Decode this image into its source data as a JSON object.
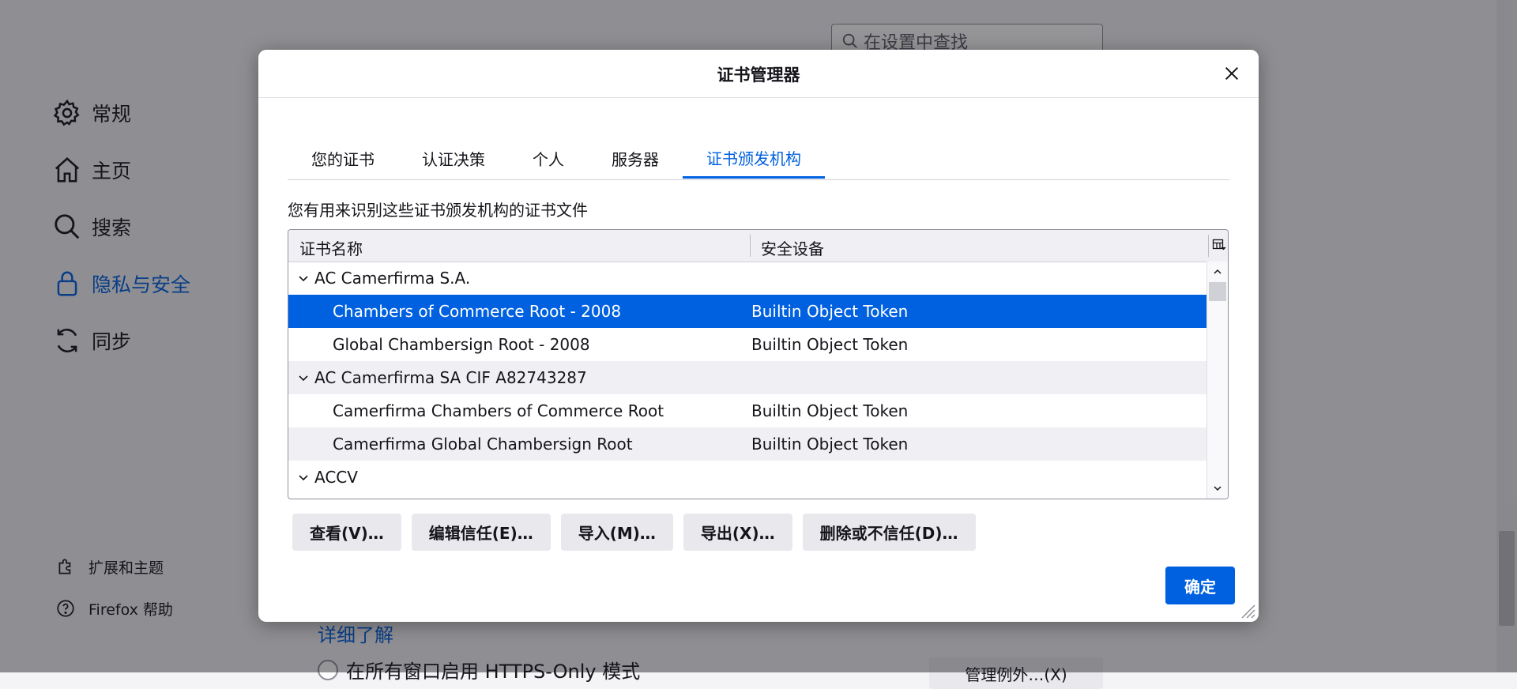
{
  "background": {
    "search_placeholder": "在设置中查找",
    "nav": [
      {
        "label": "常规",
        "icon": "gear-icon"
      },
      {
        "label": "主页",
        "icon": "home-icon"
      },
      {
        "label": "搜索",
        "icon": "search-icon"
      },
      {
        "label": "隐私与安全",
        "icon": "lock-icon",
        "active": true
      },
      {
        "label": "同步",
        "icon": "sync-icon"
      }
    ],
    "footer": [
      {
        "label": "扩展和主题",
        "icon": "puzzle-icon"
      },
      {
        "label": "Firefox 帮助",
        "icon": "help-icon"
      }
    ],
    "learn_more": "详细了解",
    "https_only_label": "在所有窗口启用 HTTPS-Only 模式",
    "manage_exceptions": "管理例外…(X)"
  },
  "dialog": {
    "title": "证书管理器",
    "tabs": [
      {
        "label": "您的证书",
        "active": false
      },
      {
        "label": "认证决策",
        "active": false
      },
      {
        "label": "个人",
        "active": false
      },
      {
        "label": "服务器",
        "active": false
      },
      {
        "label": "证书颁发机构",
        "active": true
      }
    ],
    "description": "您有用来识别这些证书颁发机构的证书文件",
    "columns": {
      "name": "证书名称",
      "device": "安全设备"
    },
    "rows": [
      {
        "type": "group",
        "name": "AC Camerfirma S.A.",
        "device": ""
      },
      {
        "type": "cert",
        "name": "Chambers of Commerce Root - 2008",
        "device": "Builtin Object Token",
        "selected": true
      },
      {
        "type": "cert",
        "name": "Global Chambersign Root - 2008",
        "device": "Builtin Object Token"
      },
      {
        "type": "group",
        "name": "AC Camerfirma SA CIF A82743287",
        "device": ""
      },
      {
        "type": "cert",
        "name": "Camerfirma Chambers of Commerce Root",
        "device": "Builtin Object Token"
      },
      {
        "type": "cert",
        "name": "Camerfirma Global Chambersign Root",
        "device": "Builtin Object Token"
      },
      {
        "type": "group",
        "name": "ACCV",
        "device": ""
      }
    ],
    "buttons": {
      "view": "查看(V)…",
      "edit_trust": "编辑信任(E)…",
      "import": "导入(M)…",
      "export": "导出(X)…",
      "delete": "删除或不信任(D)…"
    },
    "ok": "确定"
  }
}
